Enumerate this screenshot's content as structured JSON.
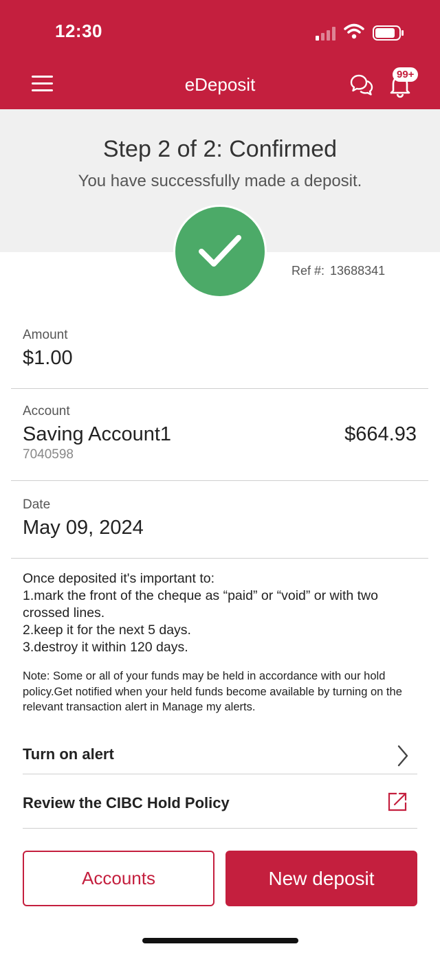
{
  "status_bar": {
    "time": "12:30"
  },
  "header": {
    "title": "eDeposit",
    "notification_badge": "99+"
  },
  "hero": {
    "title": "Step 2 of 2: Confirmed",
    "subtitle": "You have successfully made a deposit.",
    "ref_label": "Ref #:",
    "ref_number": "13688341"
  },
  "amount": {
    "label": "Amount",
    "value": "$1.00"
  },
  "account": {
    "label": "Account",
    "name": "Saving Account1",
    "number": "7040598",
    "balance": "$664.93"
  },
  "date": {
    "label": "Date",
    "value": "May 09, 2024"
  },
  "instructions": {
    "intro": "Once deposited it's important to:",
    "step1": "1.mark the front of the cheque as “paid” or “void” or with two crossed lines.",
    "step2": "2.keep it for the next 5 days.",
    "step3": "3.destroy it within 120 days."
  },
  "note": "Note: Some or all of your funds may be held in accordance with our hold policy.Get notified when your held funds become available by turning on the relevant transaction alert in Manage my alerts.",
  "links": {
    "turn_on_alert": "Turn on alert",
    "hold_policy": "Review the CIBC Hold Policy"
  },
  "buttons": {
    "accounts": "Accounts",
    "new_deposit": "New deposit"
  },
  "colors": {
    "brand_red": "#c41f3e",
    "success_green": "#4caa68",
    "hero_background": "#f0f0f0"
  },
  "icons": {
    "menu": "hamburger-menu-icon",
    "chat": "chat-bubbles-icon",
    "bell": "bell-icon",
    "check": "checkmark-icon",
    "chevron": "chevron-right-icon",
    "external": "external-link-icon"
  }
}
